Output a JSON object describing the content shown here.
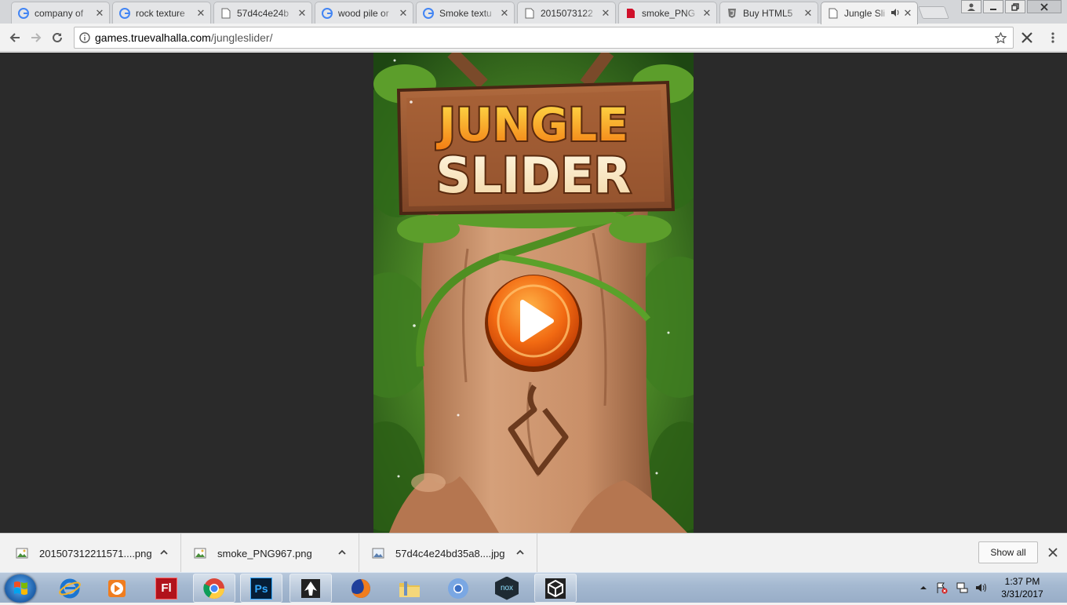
{
  "browser": {
    "tabs": [
      {
        "title": "company of",
        "icon": "google-icon"
      },
      {
        "title": "rock texture",
        "icon": "google-icon"
      },
      {
        "title": "57d4c4e24b",
        "icon": "page-icon"
      },
      {
        "title": "wood pile or",
        "icon": "google-icon"
      },
      {
        "title": "Smoke textu",
        "icon": "google-icon"
      },
      {
        "title": "2015073122",
        "icon": "page-icon"
      },
      {
        "title": "smoke_PNG",
        "icon": "red-page-icon"
      },
      {
        "title": "Buy HTML5",
        "icon": "html5-icon"
      },
      {
        "title": "Jungle Sli",
        "icon": "page-icon",
        "active": true,
        "audio": true
      }
    ],
    "url_host": "games.truevalhalla.com",
    "url_path": "/jungleslider/"
  },
  "game": {
    "title_line1": "JUNGLE",
    "title_line2": "SLIDER",
    "play_icon": "play-icon"
  },
  "downloads": {
    "items": [
      {
        "name": "201507312211571....png"
      },
      {
        "name": "smoke_PNG967.png"
      },
      {
        "name": "57d4c4e24bd35a8....jpg"
      }
    ],
    "show_all_label": "Show all"
  },
  "taskbar": {
    "apps": [
      "internet-explorer-icon",
      "media-player-icon",
      "flash-icon",
      "chrome-icon",
      "photoshop-icon",
      "inkscape-icon",
      "firefox-icon",
      "file-explorer-icon",
      "chromium-icon",
      "nox-icon",
      "unity-icon"
    ],
    "flash_label": "Fl",
    "ps_label": "Ps",
    "nox_label": "nox",
    "time": "1:37 PM",
    "date": "3/31/2017"
  },
  "colors": {
    "accent_orange": "#f26a12",
    "jungle_green": "#3e7a1f",
    "trunk": "#c58b63"
  }
}
